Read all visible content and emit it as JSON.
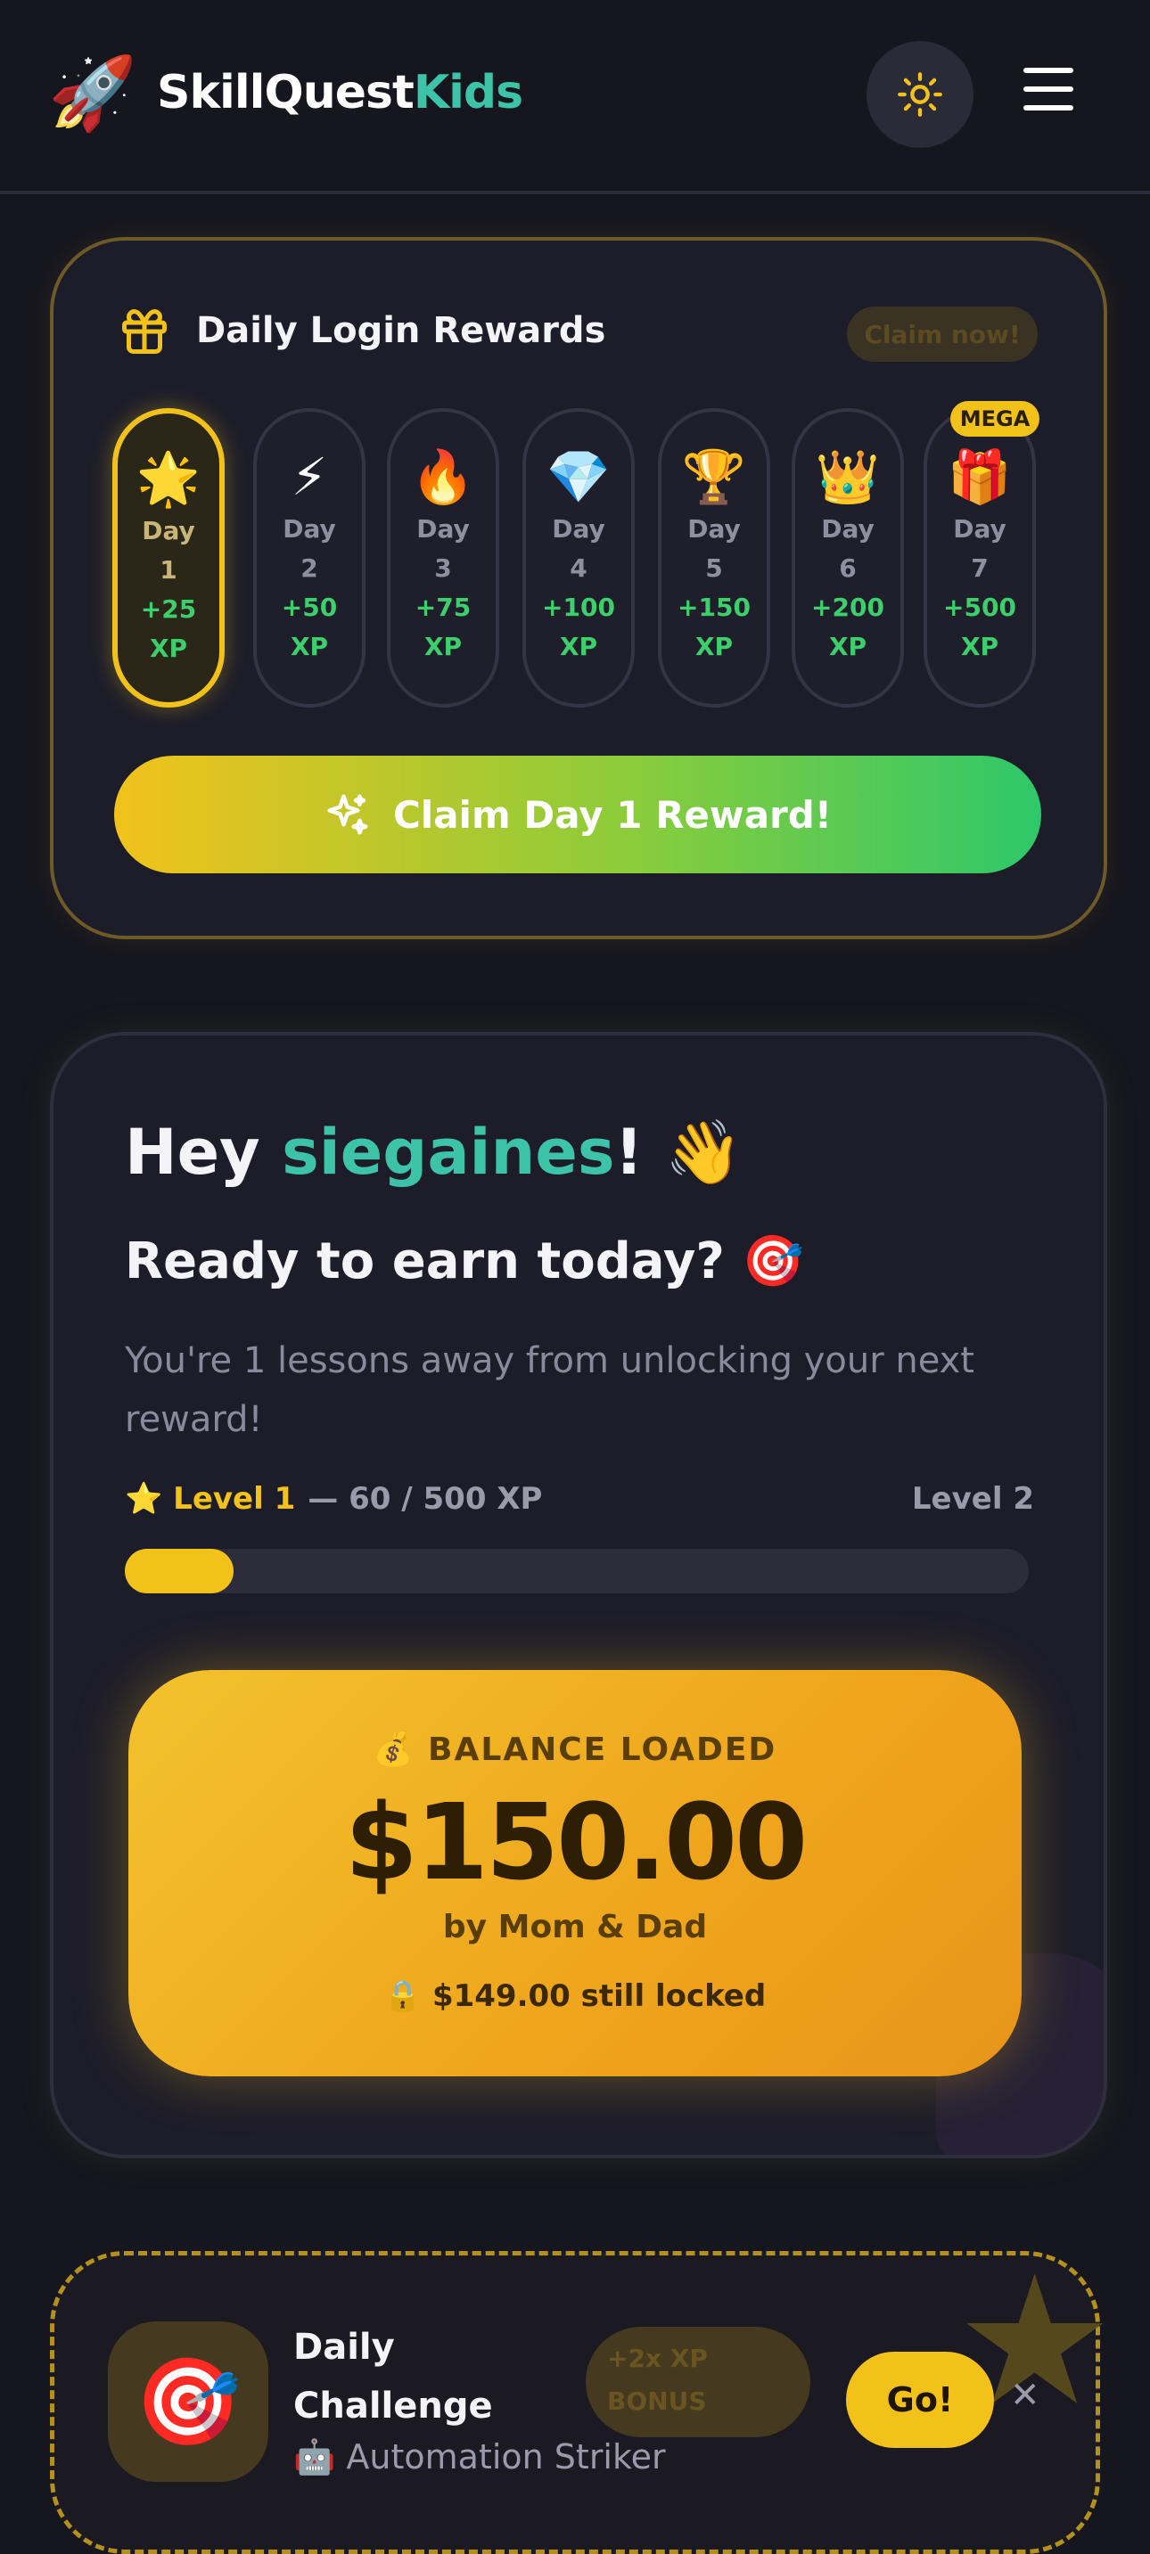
{
  "header": {
    "logo_icon": "🚀",
    "brand_primary": "SkillQuest",
    "brand_accent": "Kids",
    "theme_toggle_icon": "sun-icon",
    "menu_icon": "hamburger-menu-icon"
  },
  "rewards": {
    "title": "Daily Login Rewards",
    "claim_badge": "Claim now!",
    "mega_badge": "MEGA",
    "days": [
      {
        "emoji": "🌟",
        "label": "Day",
        "number": "1",
        "xp": "+25",
        "unit": "XP",
        "active": true
      },
      {
        "emoji": "⚡",
        "label": "Day",
        "number": "2",
        "xp": "+50",
        "unit": "XP",
        "active": false
      },
      {
        "emoji": "🔥",
        "label": "Day",
        "number": "3",
        "xp": "+75",
        "unit": "XP",
        "active": false
      },
      {
        "emoji": "💎",
        "label": "Day",
        "number": "4",
        "xp": "+100",
        "unit": "XP",
        "active": false
      },
      {
        "emoji": "🏆",
        "label": "Day",
        "number": "5",
        "xp": "+150",
        "unit": "XP",
        "active": false
      },
      {
        "emoji": "👑",
        "label": "Day",
        "number": "6",
        "xp": "+200",
        "unit": "XP",
        "active": false
      },
      {
        "emoji": "🎁",
        "label": "Day",
        "number": "7",
        "xp": "+500",
        "unit": "XP",
        "active": false
      }
    ],
    "claim_button": "Claim Day 1 Reward!"
  },
  "hero": {
    "greeting": "Hey",
    "username": "siegaines",
    "greeting_end": "! 👋",
    "headline": "Ready to earn today? 🎯",
    "subtitle": "You're 1 lessons away from unlocking your next reward!",
    "level_current": "⭐ Level 1",
    "xp_progress": "— 60 / 500 XP",
    "level_next": "Level 2",
    "progress_fraction": 0.12
  },
  "balance": {
    "label": "💰 BALANCE LOADED",
    "amount": "$150.00",
    "by": "by Mom & Dad",
    "locked": "🔒 $149.00 still locked"
  },
  "challenge": {
    "icon": "🎯",
    "title": "Daily Challenge",
    "subtitle": "🤖 Automation Striker",
    "bonus": "+2x XP BONUS",
    "go_button": "Go!",
    "close": "✕"
  },
  "colors": {
    "accent_yellow": "#f2c21b",
    "accent_teal": "#3cc3a8",
    "accent_green": "#3ccf6c",
    "background": "#16161f"
  }
}
